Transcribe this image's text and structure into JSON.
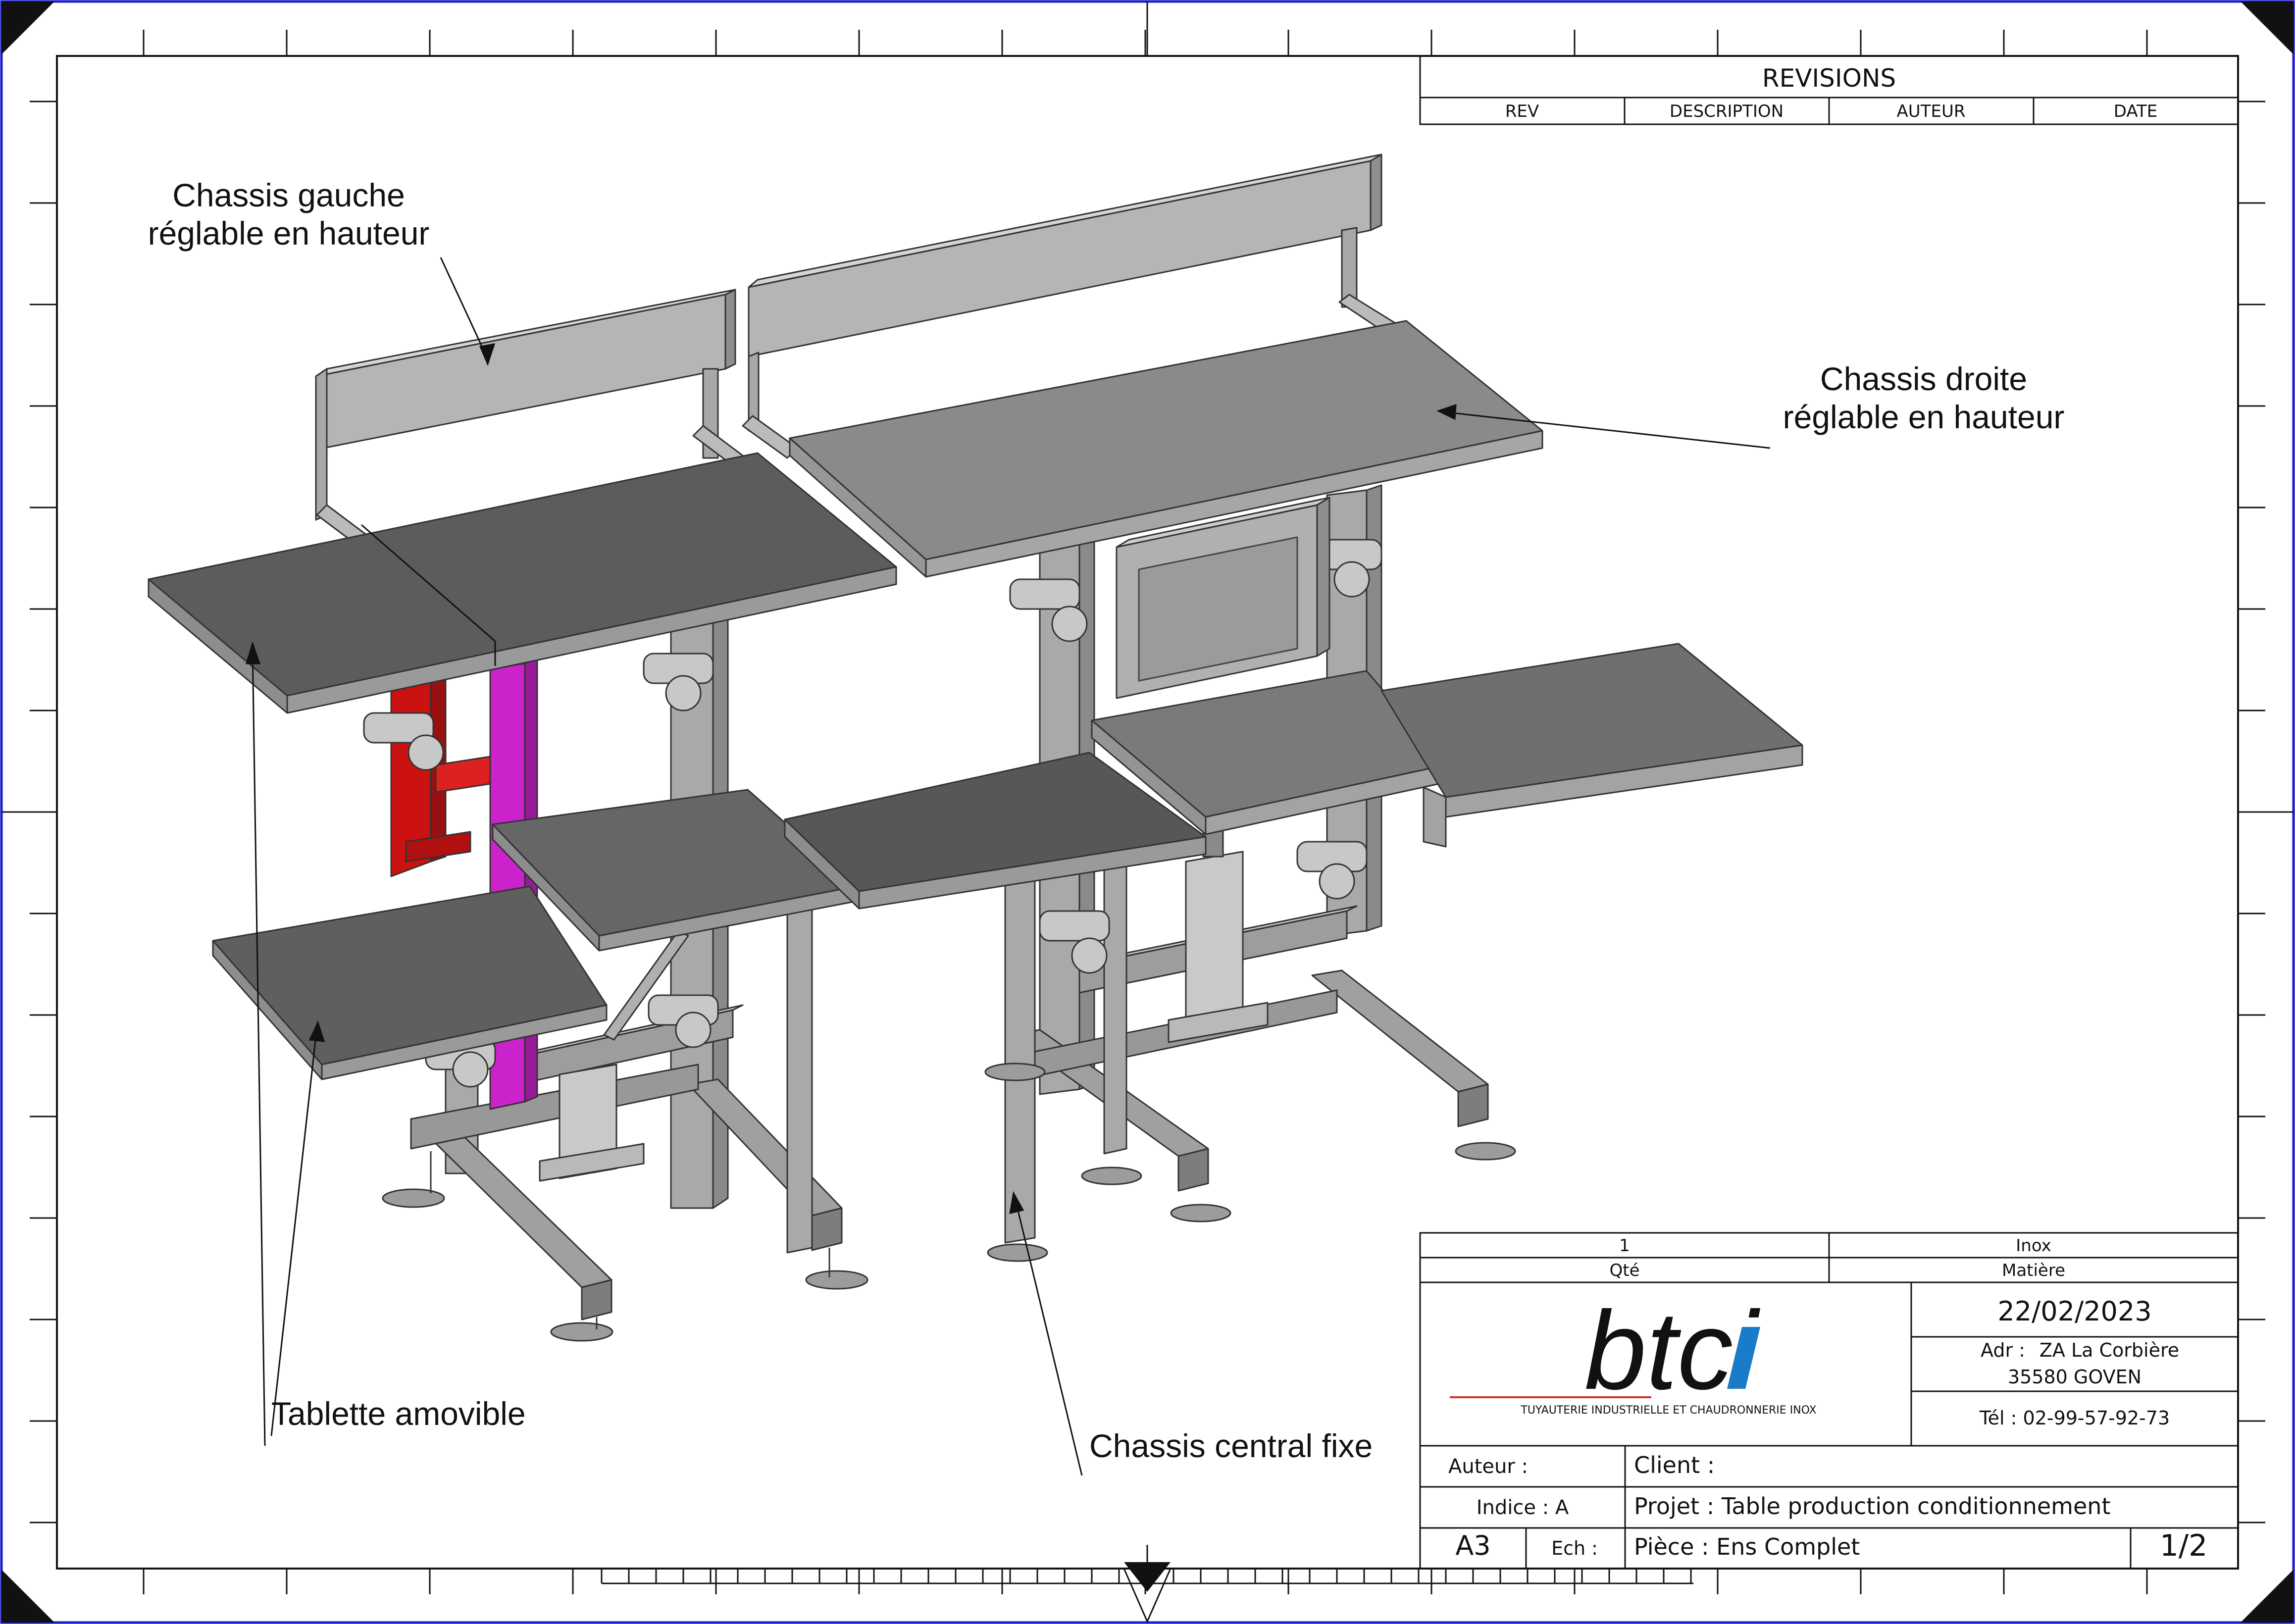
{
  "revisions": {
    "title": "REVISIONS",
    "columns": [
      "REV",
      "DESCRIPTION",
      "AUTEUR",
      "DATE"
    ]
  },
  "callouts": {
    "left_chassis": [
      "Chassis gauche",
      "réglable en hauteur"
    ],
    "right_chassis": [
      "Chassis droite",
      "réglable en hauteur"
    ],
    "shelf": "Tablette amovible",
    "central": "Chassis central fixe"
  },
  "title_block": {
    "qty": "1",
    "qty_label": "Qté",
    "material": "Inox",
    "material_label": "Matière",
    "date": "22/02/2023",
    "address_label": "Adr :",
    "address_line1": "ZA La Corbière",
    "address_line2": "35580 GOVEN",
    "phone": "Tél : 02-99-57-92-73",
    "logo_text": "btci",
    "logo_tagline": "TUYAUTERIE INDUSTRIELLE ET CHAUDRONNERIE INOX",
    "author_label": "Auteur :",
    "client_label": "Client :",
    "index_label": "Indice : A",
    "project": "Projet : Table production conditionnement",
    "format": "A3",
    "scale_label": "Ech :",
    "part": "Pièce : Ens Complet",
    "sheet": "1/2"
  },
  "colors": {
    "border": "#1b1bd0",
    "frame": "#111111",
    "steel_light": "#b5b5b5",
    "steel_mid": "#8c8c8c",
    "steel_dark": "#636363",
    "red_part": "#cc1111",
    "magenta_part": "#cc22cc",
    "logo_grey": "#8a8a8a",
    "logo_blue": "#1a7bc8",
    "logo_red_line": "#c33"
  }
}
